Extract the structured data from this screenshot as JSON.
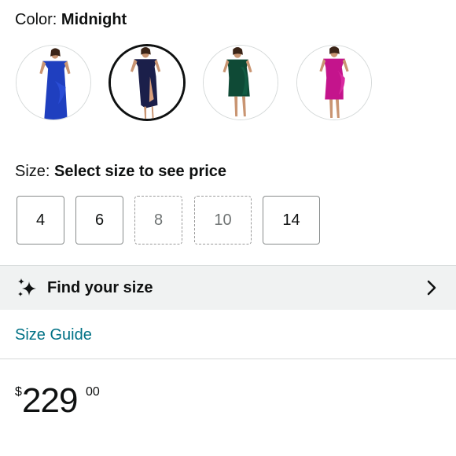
{
  "color": {
    "label": "Color: ",
    "value": "Midnight",
    "swatches": [
      {
        "name": "Royal Blue",
        "dress_color": "#1f3fbf",
        "selected": false
      },
      {
        "name": "Midnight",
        "dress_color": "#1b1f4a",
        "selected": true
      },
      {
        "name": "Hunter Green",
        "dress_color": "#0f4a36",
        "selected": false
      },
      {
        "name": "Magenta",
        "dress_color": "#c4148c",
        "selected": false
      }
    ]
  },
  "size": {
    "label": "Size: ",
    "value": "Select size to see price",
    "options": [
      {
        "label": "4",
        "available": true
      },
      {
        "label": "6",
        "available": true
      },
      {
        "label": "8",
        "available": false
      },
      {
        "label": "10",
        "available": false
      },
      {
        "label": "14",
        "available": true
      }
    ]
  },
  "find_size": {
    "label": "Find your size",
    "icon": "sparkle-icon",
    "chevron_icon": "chevron-right-icon"
  },
  "size_guide": {
    "label": "Size Guide"
  },
  "price": {
    "symbol": "$",
    "whole": "229",
    "fraction": "00"
  },
  "colors": {
    "link": "#007185",
    "text": "#0f1111",
    "band_bg": "#f0f2f2"
  }
}
